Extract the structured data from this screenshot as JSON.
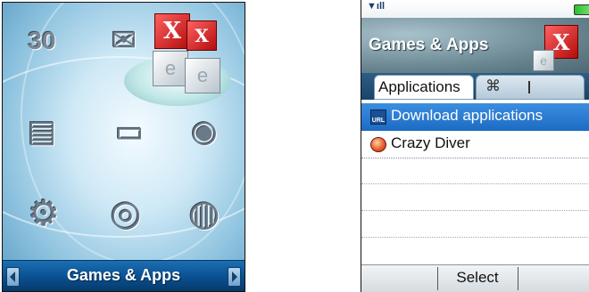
{
  "left_screen": {
    "menu_title": "Games & Apps",
    "icons": [
      {
        "name": "calendar-icon",
        "glyph": "30"
      },
      {
        "name": "mailbox-icon",
        "glyph": "✉"
      },
      {
        "name": "games-apps-cubes-icon",
        "glyph": "X"
      },
      {
        "name": "contacts-book-icon",
        "glyph": "▤"
      },
      {
        "name": "briefcase-icon",
        "glyph": "▭"
      },
      {
        "name": "camera-icon",
        "glyph": "◉"
      },
      {
        "name": "settings-gears-icon",
        "glyph": "⚙"
      },
      {
        "name": "media-player-icon",
        "glyph": "◎"
      },
      {
        "name": "connectivity-globe-icon",
        "glyph": "◍"
      }
    ]
  },
  "right_screen": {
    "header_title": "Games & Apps",
    "tabs": {
      "active_label": "Applications"
    },
    "list": [
      {
        "label": "Download applications",
        "icon": "url-download-icon",
        "selected": true
      },
      {
        "label": "Crazy Diver",
        "icon": "crazy-diver-icon",
        "selected": false
      }
    ],
    "softkeys": {
      "center": "Select"
    }
  },
  "colors": {
    "selection": "#1e6cc4",
    "menu_bar": "#0a4f8f",
    "header": "#6a8792"
  }
}
